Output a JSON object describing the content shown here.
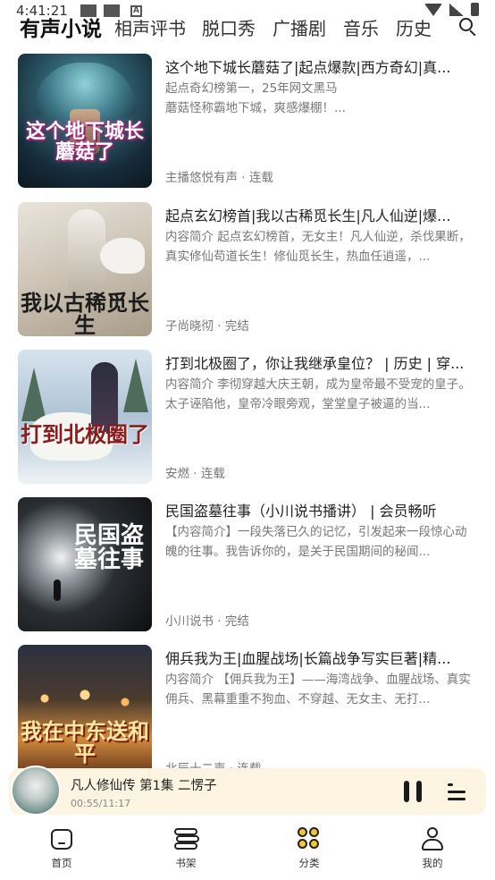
{
  "status_bar": {
    "time": "4:41:21"
  },
  "top_nav": {
    "tabs": [
      {
        "label": "有声小说",
        "active": true
      },
      {
        "label": "相声评书",
        "active": false
      },
      {
        "label": "脱口秀",
        "active": false
      },
      {
        "label": "广播剧",
        "active": false
      },
      {
        "label": "音乐",
        "active": false
      },
      {
        "label": "历史",
        "active": false
      }
    ],
    "search_icon": "search-icon"
  },
  "books": [
    {
      "title": "这个地下城长蘑菇了|起点爆款|西方奇幻|真...",
      "desc": "起点奇幻榜第一，25年网文黑马\n蘑菇怪称霸地下城，爽感爆棚！...",
      "meta": "主播悠悦有声 · 连载",
      "cover_text": "这个地下城长蘑菇了"
    },
    {
      "title": "起点玄幻榜首|我以古稀觅长生|凡人仙逆|爆...",
      "desc": "内容简介 起点玄幻榜首，无女主！凡人仙逆，杀伐果断，真实修仙苟道长生！修仙觅长生，热血任逍遥，...",
      "meta": "子尚晓彻 · 完结",
      "cover_text": "我以古稀觅长生"
    },
    {
      "title": "打到北极圈了，你让我继承皇位？ | 历史 | 穿...",
      "desc": "内容简介 李彻穿越大庆王朝，成为皇帝最不受宠的皇子。太子诬陷他，皇帝冷眼旁观，堂堂皇子被逼的当...",
      "meta": "安燃 · 连载",
      "cover_text": "打到北极圈了"
    },
    {
      "title": "民国盗墓往事（小川说书播讲） | 会员畅听",
      "desc": "【内容简介】一段失落已久的记忆，引发起来一段惊心动魄的往事。我告诉你的，是关于民国期间的秘闻...",
      "meta": "小川说书 · 完结",
      "cover_text": "民国盗墓往事"
    },
    {
      "title": "佣兵我为王|血腥战场|长篇战争写实巨著|精...",
      "desc": "内容简介 【佣兵我为王】——海湾战争、血腥战场、真实佣兵、黑幕重重不狗血、不穿越、无女主、无打...",
      "meta": "北辰十二声 · 连载",
      "cover_text": "我在中东送和平"
    }
  ],
  "player": {
    "title": "凡人修仙传 第1集 二愣子",
    "time": "00:55/11:17"
  },
  "bottom_nav": {
    "items": [
      {
        "label": "首页",
        "icon": "home-icon"
      },
      {
        "label": "书架",
        "icon": "bookshelf-icon"
      },
      {
        "label": "分类",
        "icon": "category-icon",
        "active": true
      },
      {
        "label": "我的",
        "icon": "profile-icon"
      }
    ]
  },
  "colors": {
    "accent": "#f7c531",
    "player_bg": "#fdf5e2",
    "meta_text": "#777777"
  }
}
